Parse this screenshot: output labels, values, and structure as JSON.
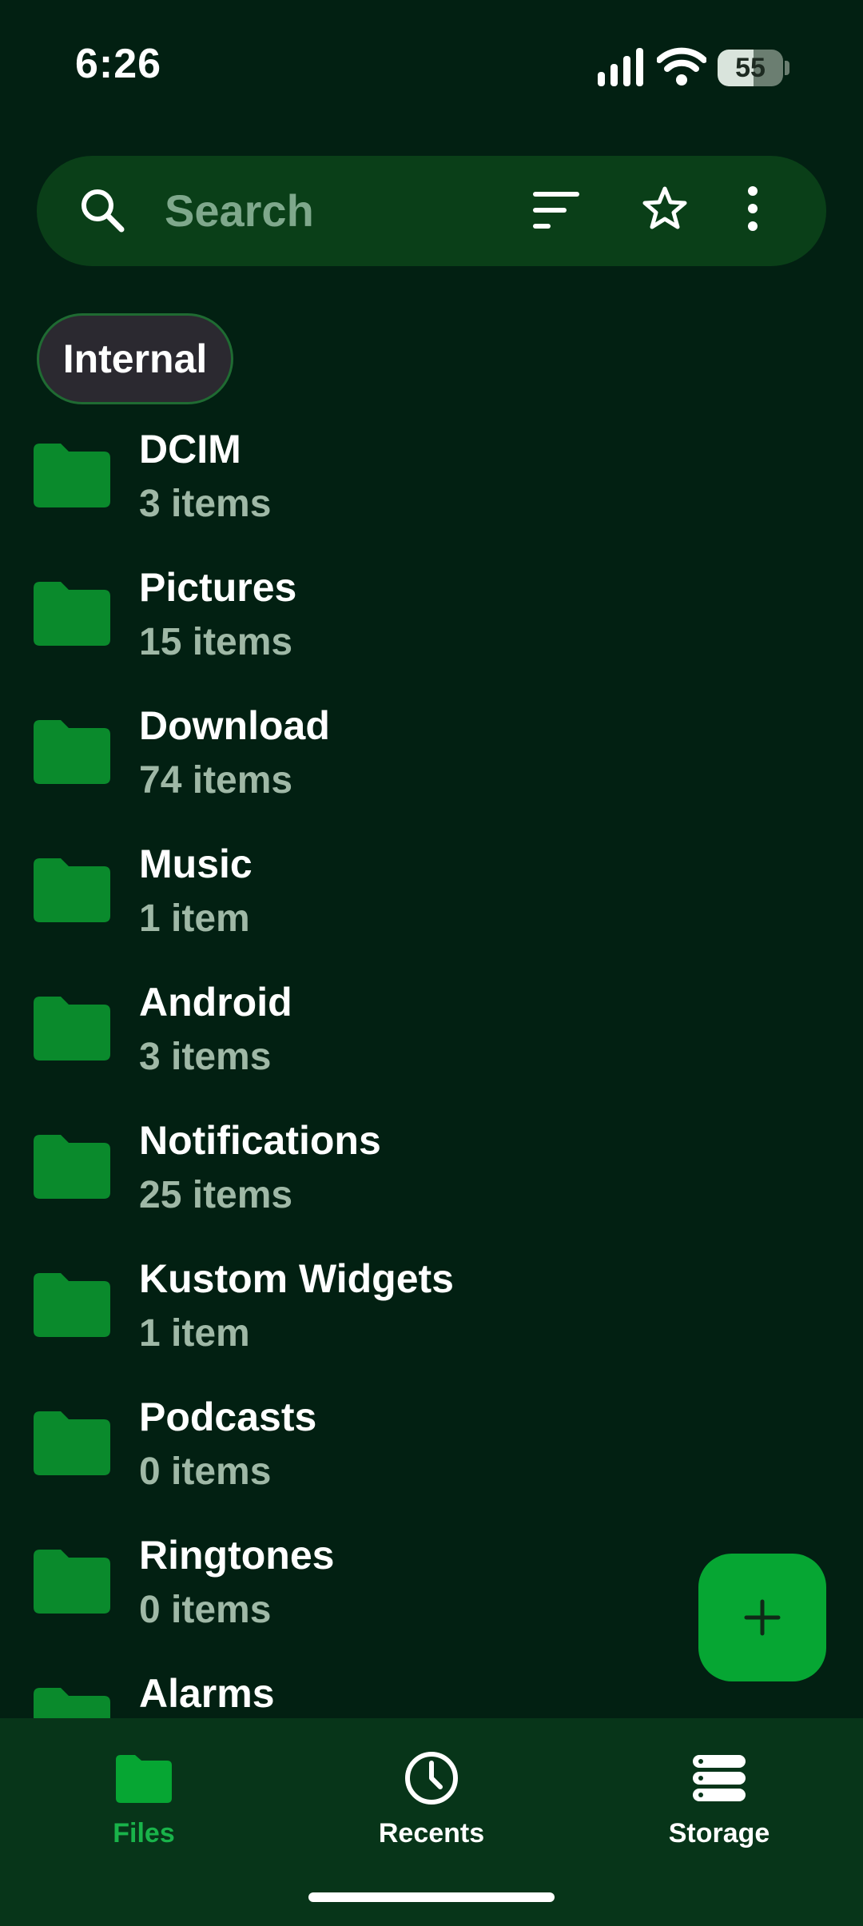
{
  "status_bar": {
    "time": "6:26",
    "battery_level": "55",
    "battery_fraction": 0.55
  },
  "search": {
    "placeholder": "Search"
  },
  "storage_chip": {
    "label": "Internal"
  },
  "files": [
    {
      "name": "DCIM",
      "count": "3 items"
    },
    {
      "name": "Pictures",
      "count": "15 items"
    },
    {
      "name": "Download",
      "count": "74 items"
    },
    {
      "name": "Music",
      "count": "1 item"
    },
    {
      "name": "Android",
      "count": "3 items"
    },
    {
      "name": "Notifications",
      "count": "25 items"
    },
    {
      "name": "Kustom Widgets",
      "count": "1 item"
    },
    {
      "name": "Podcasts",
      "count": "0 items"
    },
    {
      "name": "Ringtones",
      "count": "0 items"
    },
    {
      "name": "Alarms",
      "count": ""
    }
  ],
  "bottom_nav": {
    "items": [
      {
        "label": "Files",
        "icon": "folder-icon",
        "active": true
      },
      {
        "label": "Recents",
        "icon": "clock-icon",
        "active": false
      },
      {
        "label": "Storage",
        "icon": "storage-icon",
        "active": false
      }
    ]
  },
  "colors": {
    "background": "#022012",
    "accent": "#06a633",
    "folder": "#0a8a2c",
    "nav_background": "#073519",
    "search_background": "#0a3f18"
  },
  "icons": {
    "search": "search-icon",
    "sort": "sort-icon",
    "favorites": "star-icon",
    "menu": "more-vert-icon",
    "fab": "plus-icon"
  }
}
